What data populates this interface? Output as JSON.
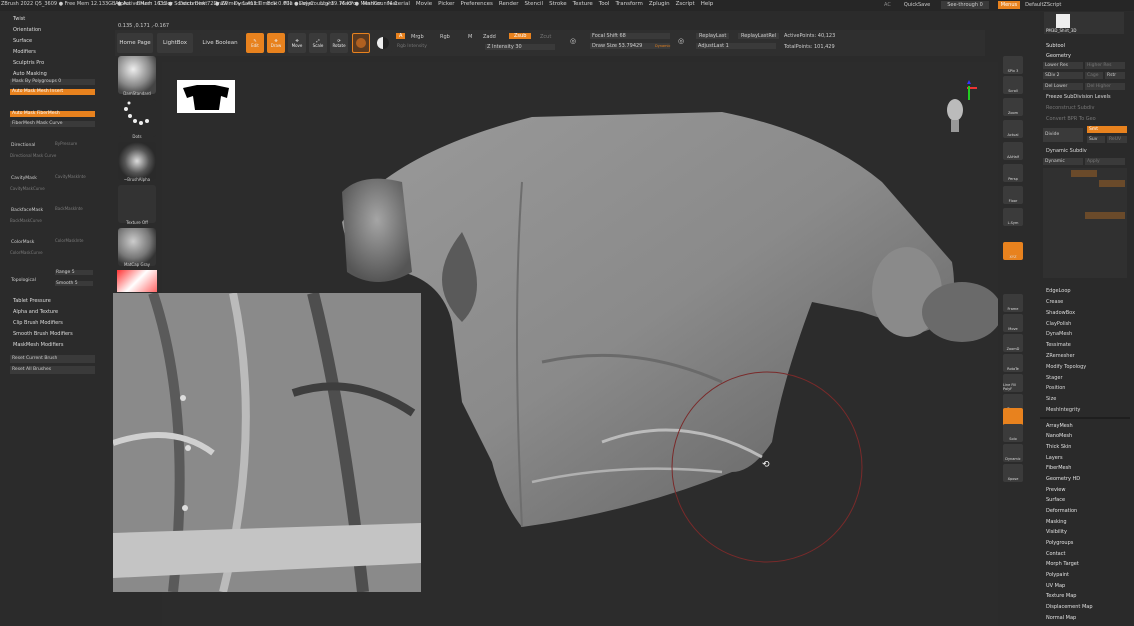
{
  "app": {
    "title": "ZBrush 2022",
    "info": "ZBrush 2022   Q5_3609   ● Free Mem 12.133GB ● Active Mem 1631 ● Scratch Disk 72 ● ZTime ▸ 1.413 Timer ▸ 0.001 ● PolyCount ▸ 39.76 KP ● MeshCount ▸ 1"
  },
  "menu": [
    "Alpha",
    "Brush",
    "Color",
    "Document",
    "Draw",
    "Dynamics",
    "Edit",
    "File",
    "Layer",
    "Light",
    "Macro",
    "Marker",
    "Material",
    "Movie",
    "Picker",
    "Preferences",
    "Render",
    "Stencil",
    "Stroke",
    "Texture",
    "Tool",
    "Transform",
    "Zplugin",
    "Zscript",
    "Help"
  ],
  "topright": {
    "ac": "AC",
    "quicksave": "QuickSave",
    "seethrough": "See-through  0",
    "menus": "Menus",
    "script": "DefaultZScript"
  },
  "coords": "0.135 ,0.171 ,-0.167",
  "toolbar": {
    "home": "Home Page",
    "lightbox": "LightBox",
    "liveboolean": "Live Boolean",
    "edit": "Edit",
    "draw": "Draw",
    "move": "Move",
    "scale": "Scale",
    "rotate": "Rotate",
    "a": "A",
    "mrgb": "Mrgb",
    "rgb": "Rgb",
    "m": "M",
    "zadd": "Zadd",
    "zsub": "Zsub",
    "zcut": "Zcut",
    "rgb_intensity": "Rgb Intensity",
    "z_intensity": "Z Intensity 30",
    "focal": "Focal Shift 68",
    "drawsize": "Draw Size 53.79429",
    "dynamic": "Dynamic",
    "replaylast": "ReplayLast",
    "replaylastrel": "ReplayLastRel",
    "adjustlast": "AdjustLast  1",
    "activepoints": "ActivePoints: 40,123",
    "totalpoints": "TotalPoints: 101,429"
  },
  "leftpanel": {
    "headers": [
      "Twist",
      "Orientation",
      "Surface",
      "Modifiers",
      "Sculptris Pro"
    ],
    "automasking": "Auto Masking",
    "maskbypoly": "Mask By Polygroups 0",
    "automaskinsert": "Auto Mask Mesh Insert",
    "automaskfiber": "Auto Mask FiberMesh",
    "fibermaskcurve": "FiberMesh Mask Curve",
    "directional": "Directional",
    "bypressure": "ByPressure",
    "dirmaskcurve": "Directional Mask Curve",
    "cavitymask": "CavityMask",
    "cavityintensity": "CavityMaskInte",
    "cavitycurve": "CavityMaskCurve",
    "backfacemask": "BackfaceMask",
    "backfaceint": "BackMaskInte",
    "backfacecurve": "BackMaskCurve",
    "colormask": "ColorMask",
    "colorint": "ColorMaskInte",
    "colorcurve": "ColorMaskCurve",
    "topological": "Topological",
    "range": "Range 5",
    "smooth": "Smooth 5",
    "footer": [
      "Tablet Pressure",
      "Alpha and Texture",
      "Clip Brush Modifiers",
      "Smooth Brush Modifiers",
      "MaskMesh Modifiers"
    ],
    "reset1": "Reset Current Brush",
    "reset2": "Reset All Brushes"
  },
  "brushes": {
    "standard": "DamStandard",
    "dots": "Dots",
    "alpha": "~BrushAlpha",
    "texture": "Texture Off",
    "matcap": "MatCap Gray"
  },
  "shelf": [
    "SPix 3",
    "Scroll",
    "Zoom",
    "Actual",
    "AAHalf",
    "Persp",
    "Floor",
    "L.Sym",
    "",
    "XYZ",
    "",
    "",
    "Frame",
    "Move",
    "ZoomD",
    "RotaTe",
    "Line Fill PolyF",
    "Transp",
    "",
    "Solo",
    "Dynamic",
    "Xpose"
  ],
  "rightpanel": {
    "preview": "PM3D_Shirt_3D",
    "subtool": "Subtool",
    "geometry": "Geometry",
    "lowerres": "Lower Res",
    "higherres": "Higher Res",
    "sdiv": "SDiv 2",
    "cage": "Cage",
    "rstr": "Rstr",
    "dellower": "Del Lower",
    "delhigher": "Del Higher",
    "freeze": "Freeze SubDivision Levels",
    "reconstruct": "Reconstruct Subdiv",
    "convert": "Convert BPR To Geo",
    "divide": "Divide",
    "smt": "Smt",
    "suv": "Suv",
    "reuv": "ReUV",
    "dynsub": "Dynamic Subdiv",
    "dynamic": "Dynamic",
    "apply": "Apply",
    "sections": [
      "EdgeLoop",
      "Crease",
      "ShadowBox",
      "ClayPolish",
      "DynaMesh",
      "Tessimate",
      "ZRemesher",
      "Modify Topology",
      "Stager",
      "Position",
      "Size",
      "MeshIntegrity"
    ],
    "list": [
      "ArrayMesh",
      "NanoMesh",
      "Thick Skin",
      "Layers",
      "FiberMesh",
      "Geometry HD",
      "Preview",
      "Surface",
      "Deformation",
      "Masking",
      "Visibility",
      "Polygroups",
      "Contact",
      "Morph Target",
      "Polypaint",
      "UV Map",
      "Texture Map",
      "Displacement Map",
      "Normal Map"
    ]
  }
}
